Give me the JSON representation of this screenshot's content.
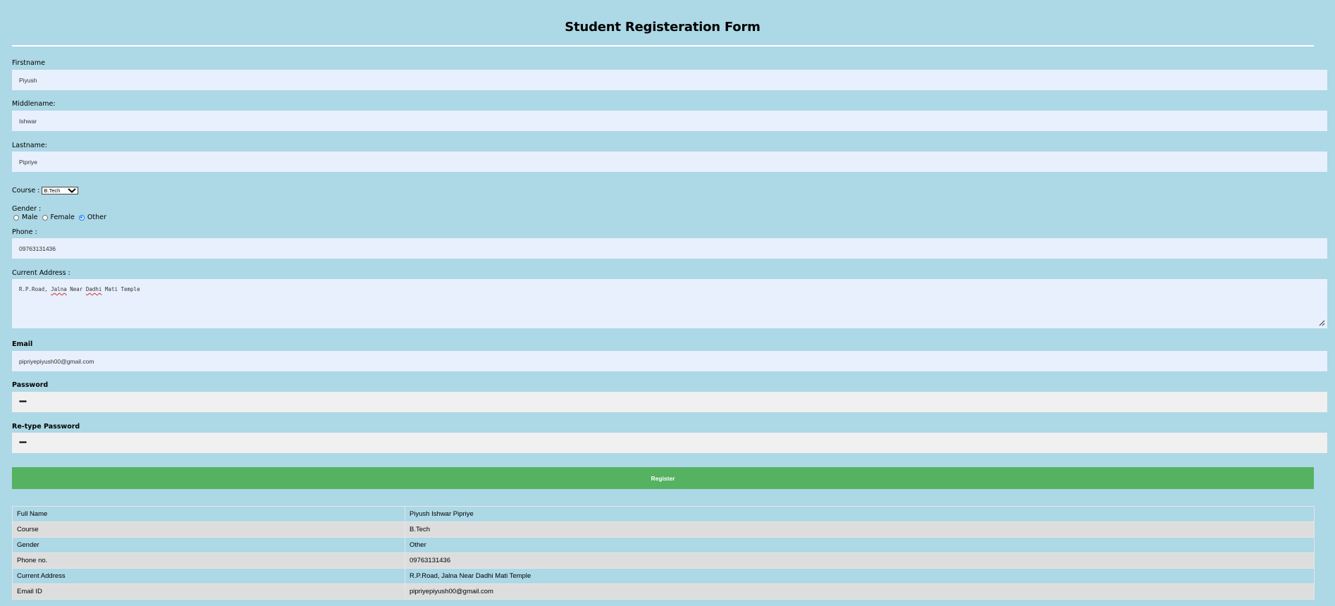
{
  "form": {
    "title": "Student Registeration Form",
    "firstname": {
      "label": "Firstname",
      "value": "Piyush"
    },
    "middlename": {
      "label": "Middlename:",
      "value": "Ishwar"
    },
    "lastname": {
      "label": "Lastname:",
      "value": "Pipriye"
    },
    "course": {
      "label": "Course :",
      "selected": "B.Tech"
    },
    "gender": {
      "label": "Gender :",
      "options": [
        {
          "label": "Male",
          "checked": false
        },
        {
          "label": "Female",
          "checked": false
        },
        {
          "label": "Other",
          "checked": true
        }
      ]
    },
    "phone": {
      "label": "Phone :",
      "value": "09763131436"
    },
    "address": {
      "label": "Current Address :",
      "value": "R.P.Road, Jalna Near Dadhi Mati Temple",
      "parts": [
        "R.P.Road, ",
        "Jalna",
        " Near ",
        "Dadhi",
        " Mati Temple"
      ]
    },
    "email": {
      "label": "Email",
      "value": "pipriyepiyush00@gmail.com"
    },
    "password": {
      "label": "Password",
      "value": "••••"
    },
    "retype_password": {
      "label": "Re-type Password",
      "value": "••••"
    },
    "register_label": "Register"
  },
  "summary": {
    "rows": [
      {
        "key": "Full Name",
        "value": "Piyush Ishwar Pipriye"
      },
      {
        "key": "Course",
        "value": "B.Tech"
      },
      {
        "key": "Gender",
        "value": "Other"
      },
      {
        "key": "Phone no.",
        "value": "09763131436"
      },
      {
        "key": "Current Address",
        "value": "R.P.Road, Jalna Near Dadhi Mati Temple"
      },
      {
        "key": "Email ID",
        "value": "pipriyepiyush00@gmail.com"
      }
    ]
  },
  "colors": {
    "background": "#add8e6",
    "input_background": "#e8f0fe",
    "register_button": "#54b260",
    "radio_checked": "#0075ff"
  }
}
